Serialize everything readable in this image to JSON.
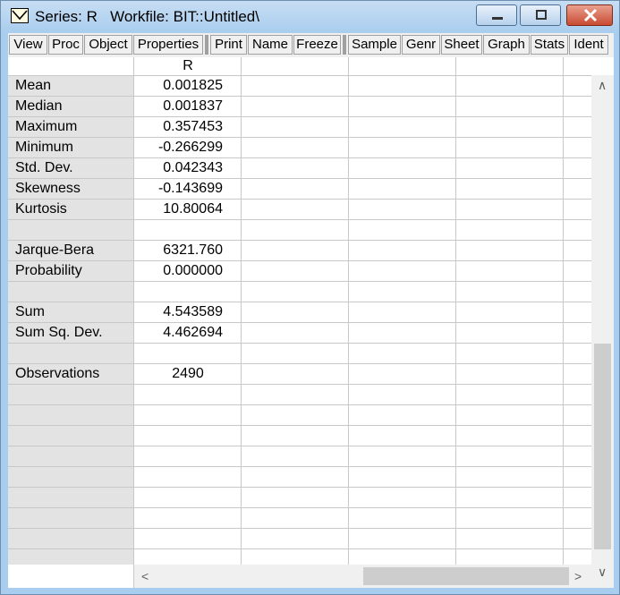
{
  "window": {
    "title": "Series: R   Workfile: BIT::Untitled\\"
  },
  "toolbar": {
    "buttons": [
      "View",
      "Proc",
      "Object",
      "Properties",
      "Print",
      "Name",
      "Freeze",
      "Sample",
      "Genr",
      "Sheet",
      "Graph",
      "Stats",
      "Ident"
    ]
  },
  "table": {
    "column_header": "R",
    "rows": [
      {
        "label": "Mean",
        "value": "0.001825"
      },
      {
        "label": "Median",
        "value": "0.001837"
      },
      {
        "label": "Maximum",
        "value": "0.357453"
      },
      {
        "label": "Minimum",
        "value": "-0.266299"
      },
      {
        "label": "Std. Dev.",
        "value": "0.042343"
      },
      {
        "label": "Skewness",
        "value": "-0.143699"
      },
      {
        "label": "Kurtosis",
        "value": "10.80064"
      },
      {
        "label": "",
        "value": ""
      },
      {
        "label": "Jarque-Bera",
        "value": "6321.760"
      },
      {
        "label": "Probability",
        "value": "0.000000"
      },
      {
        "label": "",
        "value": ""
      },
      {
        "label": "Sum",
        "value": "4.543589"
      },
      {
        "label": "Sum Sq. Dev.",
        "value": "4.462694"
      },
      {
        "label": "",
        "value": ""
      },
      {
        "label": "Observations",
        "value": "2490"
      }
    ]
  },
  "scrollbars": {
    "up_arrow": "∧",
    "down_arrow": "∨",
    "left_arrow": "<",
    "right_arrow": ">"
  },
  "colors": {
    "titlebar": "#a9cdee",
    "close_button": "#c84a31",
    "row_header": "#e3e3e3",
    "gridline": "#c8c8c8"
  },
  "icons": [
    "series-icon",
    "minimize-icon",
    "maximize-icon",
    "close-icon"
  ]
}
